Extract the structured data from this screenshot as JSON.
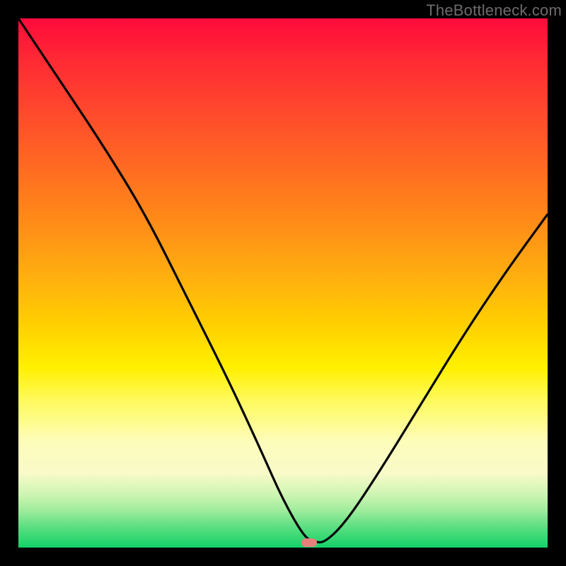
{
  "watermark": "TheBottleneck.com",
  "chart_data": {
    "type": "line",
    "title": "",
    "xlabel": "",
    "ylabel": "",
    "xlim": [
      0,
      100
    ],
    "ylim": [
      0,
      100
    ],
    "grid": false,
    "legend": null,
    "annotations": [
      {
        "name": "min-marker",
        "x": 55,
        "y": 1,
        "color": "#e77f7b"
      }
    ],
    "series": [
      {
        "name": "bottleneck-curve",
        "x": [
          0,
          8,
          16,
          24,
          32,
          40,
          46,
          50,
          54,
          56,
          58,
          62,
          68,
          76,
          84,
          92,
          100
        ],
        "values": [
          100,
          88,
          76,
          63,
          47,
          31,
          18,
          9,
          2,
          1,
          1,
          5,
          14,
          27,
          40,
          52,
          63
        ]
      }
    ],
    "background_gradient": {
      "direction": "vertical",
      "stops": [
        {
          "pos": 0,
          "color": "#ff0a3c"
        },
        {
          "pos": 18,
          "color": "#ff4a2c"
        },
        {
          "pos": 38,
          "color": "#ff8a18"
        },
        {
          "pos": 58,
          "color": "#ffd000"
        },
        {
          "pos": 72,
          "color": "#fffa5a"
        },
        {
          "pos": 86,
          "color": "#f8fac8"
        },
        {
          "pos": 93,
          "color": "#9eec9c"
        },
        {
          "pos": 100,
          "color": "#13d168"
        }
      ]
    }
  }
}
